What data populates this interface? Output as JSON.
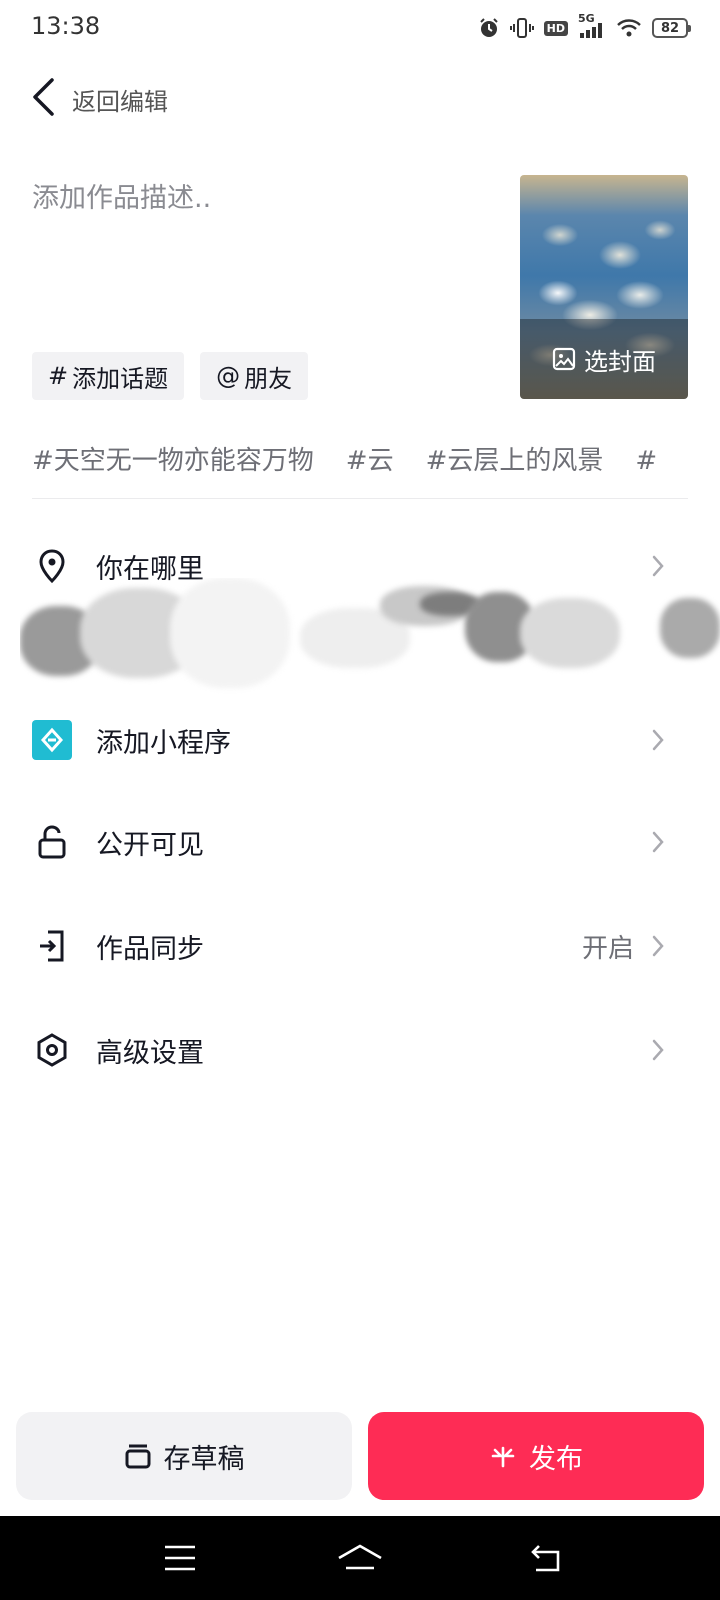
{
  "status_bar": {
    "time": "13:38",
    "network": "5G",
    "hd": "HD",
    "battery": "82"
  },
  "header": {
    "back_label": "返回编辑"
  },
  "description": {
    "placeholder": "添加作品描述.."
  },
  "chips": {
    "topic_symbol": "#",
    "topic_label": "添加话题",
    "friend_symbol": "@",
    "friend_label": "朋友"
  },
  "cover": {
    "label": "选封面"
  },
  "suggested_tags": [
    "#天空无一物亦能容万物",
    "#云",
    "#云层上的风景",
    "#"
  ],
  "menu": {
    "location": {
      "label": "你在哪里",
      "icon": "location-pin-icon"
    },
    "mini_program": {
      "label": "添加小程序",
      "icon": "mini-program-icon"
    },
    "visibility": {
      "label": "公开可见",
      "icon": "unlock-icon"
    },
    "sync": {
      "label": "作品同步",
      "value": "开启",
      "icon": "sync-export-icon"
    },
    "advanced": {
      "label": "高级设置",
      "icon": "hexagon-settings-icon"
    }
  },
  "buttons": {
    "draft_label": "存草稿",
    "publish_label": "发布"
  },
  "colors": {
    "publish_bg": "#fe2c55",
    "mini_program_bg": "#20bcd2",
    "chip_bg": "#f2f2f4"
  }
}
